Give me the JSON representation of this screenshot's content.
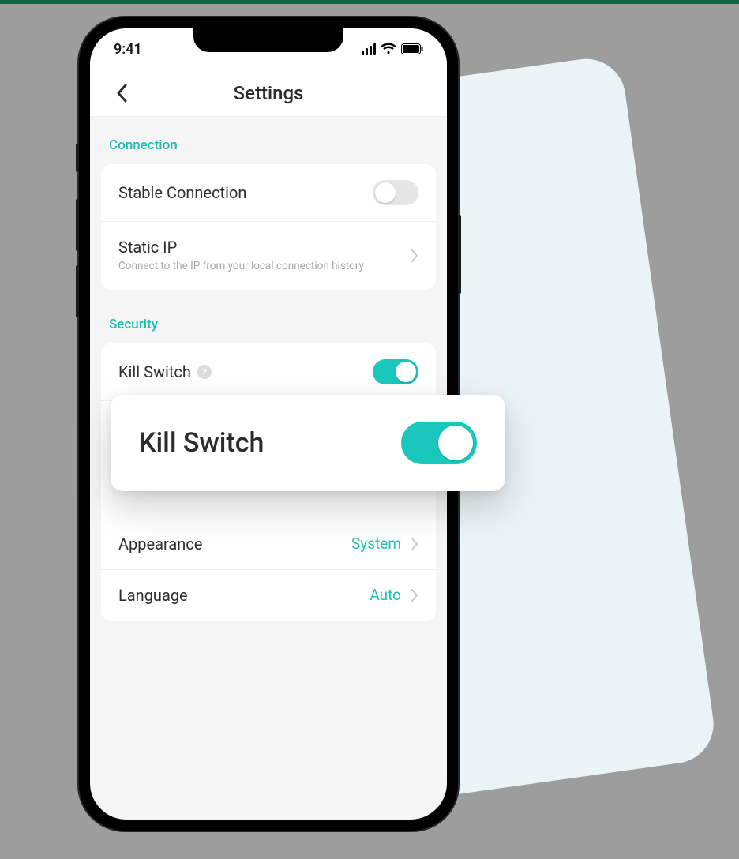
{
  "status": {
    "time": "9:41"
  },
  "nav": {
    "title": "Settings"
  },
  "sections": {
    "connection": {
      "label": "Connection",
      "stable": {
        "title": "Stable Connection",
        "on": false
      },
      "static_ip": {
        "title": "Static IP",
        "subtitle": "Connect to the IP from your local connection history"
      }
    },
    "security": {
      "label": "Security",
      "kill_switch": {
        "title": "Kill Switch",
        "on": true
      },
      "appearance": {
        "title": "Appearance",
        "value": "System"
      },
      "language": {
        "title": "Language",
        "value": "Auto"
      }
    }
  },
  "callout": {
    "title": "Kill Switch",
    "on": true
  },
  "colors": {
    "accent": "#1ac7bd",
    "accent_text": "#17c0b7"
  }
}
